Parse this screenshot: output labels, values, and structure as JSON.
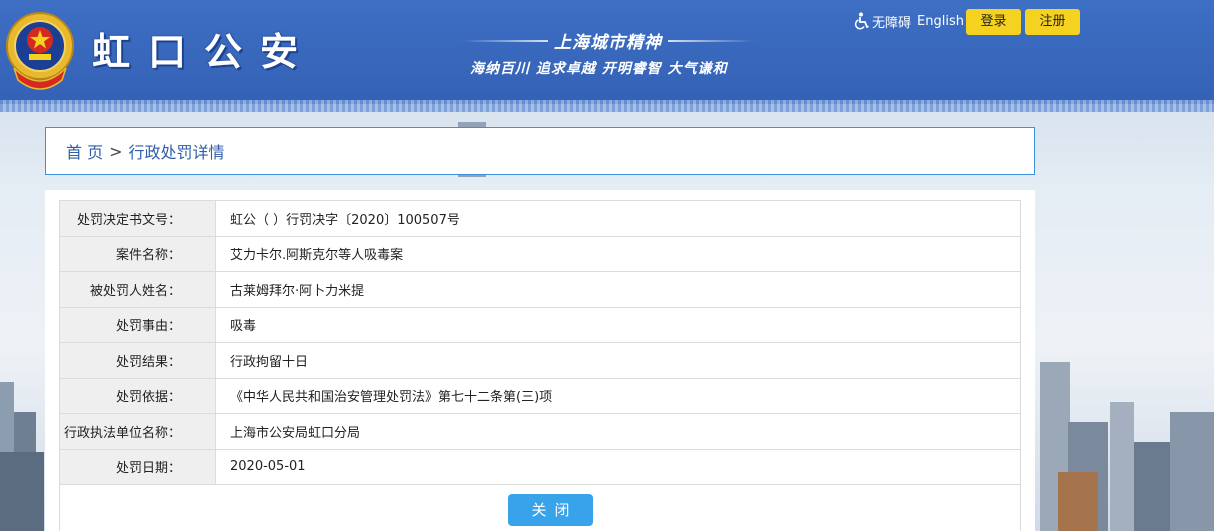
{
  "header": {
    "site_title": "虹口公安",
    "slogan_title": "上海城市精神",
    "slogan_sub": "海纳百川 追求卓越 开明睿智 大气谦和",
    "accessibility_label": "无障碍",
    "english_label": "English",
    "login_label": "登录",
    "register_label": "注册"
  },
  "breadcrumb": {
    "home": "首 页",
    "separator": ">",
    "current": "行政处罚详情"
  },
  "detail": {
    "rows": [
      {
        "label": "处罚决定书文号：",
        "value": "虹公（ ）行罚决字〔2020〕100507号"
      },
      {
        "label": "案件名称：",
        "value": "艾力卡尔.阿斯克尔等人吸毒案"
      },
      {
        "label": "被处罚人姓名：",
        "value": "古莱姆拜尔·阿卜力米提"
      },
      {
        "label": "处罚事由：",
        "value": "吸毒"
      },
      {
        "label": "处罚结果：",
        "value": "行政拘留十日"
      },
      {
        "label": "处罚依据：",
        "value": "《中华人民共和国治安管理处罚法》第七十二条第(三)项"
      },
      {
        "label": "行政执法单位名称：",
        "value": "上海市公安局虹口分局"
      },
      {
        "label": "处罚日期：",
        "value": "2020-05-01"
      }
    ],
    "close_label": "关闭"
  },
  "colors": {
    "header_blue": "#3461b5",
    "accent_yellow": "#f5d21f",
    "close_blue": "#38a3ea",
    "breadcrumb_border": "#3f8ee0"
  }
}
